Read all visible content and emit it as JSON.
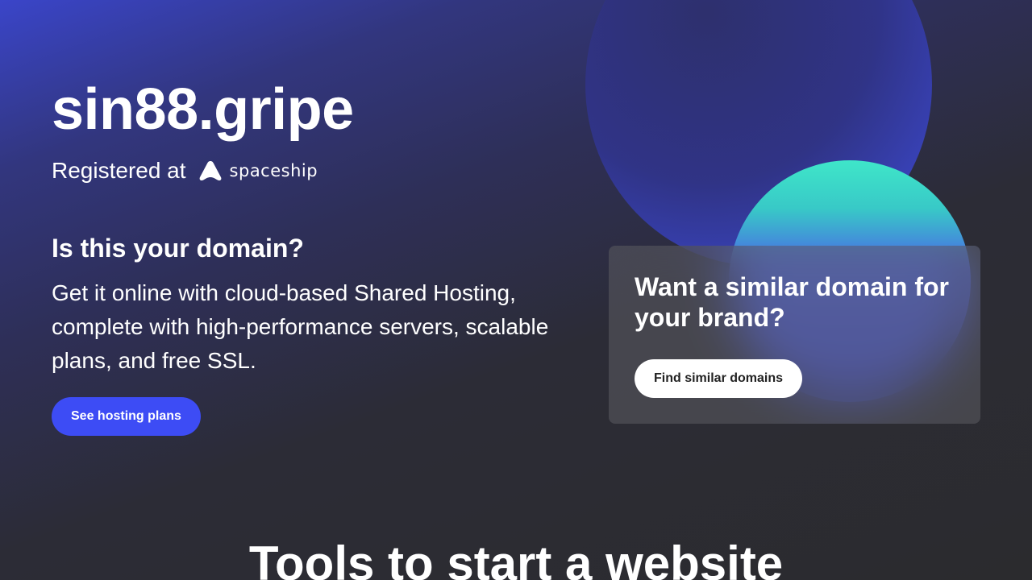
{
  "domain": {
    "name": "sin88.gripe"
  },
  "registrar": {
    "label": "Registered at",
    "brand_name": "spaceship",
    "logo_icon": "spaceship-logo-icon"
  },
  "hosting": {
    "question": "Is this your domain?",
    "description": "Get it online with cloud-based Shared Hosting, complete with high-performance servers, scalable plans, and free SSL.",
    "button_label": "See hosting plans"
  },
  "similar": {
    "title": "Want a similar domain for your brand?",
    "button_label": "Find similar domains"
  },
  "tools": {
    "heading": "Tools to start a website"
  },
  "colors": {
    "primary_button": "#3d4cf5",
    "background": "#2b2b2e",
    "orb_teal": "#3fe6c9",
    "orb_blue": "#3f4de0"
  }
}
